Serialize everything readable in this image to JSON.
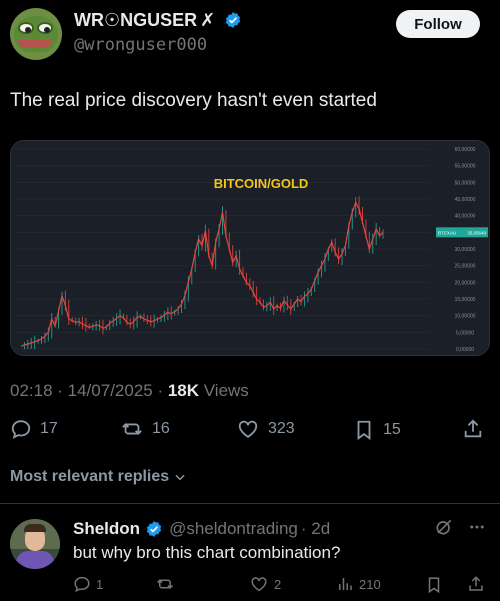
{
  "author": {
    "display_name": "WR☉NGUSER",
    "name_mark": "✗",
    "handle": "@wronguser000",
    "avatar_icon": "pepe-frog-avatar",
    "verified_icon": "verified-badge-icon",
    "verified_color": "#1d9bf0"
  },
  "follow_label": "Follow",
  "tweet": {
    "text": "The real price discovery hasn't even started",
    "timestamp": "02:18 · 14/07/2025 · ",
    "views_count": "18K",
    "views_label": " Views"
  },
  "actions": {
    "replies": "17",
    "reposts": "16",
    "likes": "323",
    "bookmarks": "15"
  },
  "replies_filter_label": "Most relevant replies",
  "reply": {
    "display_name": "Sheldon",
    "handle": "@sheldontrading",
    "age": "· 2d",
    "text": "but why bro this chart combination?",
    "replies": "1",
    "reposts": "",
    "likes": "2",
    "views": "210"
  },
  "chart_data": {
    "type": "line",
    "title": "BITCOIN/GOLD",
    "title_color": "#f5c518",
    "line_color": "#e8453c",
    "up_color": "#26a69a",
    "y_ticks": [
      "60,00000",
      "55,00000",
      "50,00000",
      "45,00000",
      "40,00000",
      "35,00000",
      "30,00000",
      "25,00000",
      "20,00000",
      "15,00000",
      "10,00000",
      "5,00000",
      "0,00000"
    ],
    "ylim": [
      0,
      60
    ],
    "price_tag_symbol": "BTCXAU",
    "price_tag_value": "35,05649",
    "price_tag_color": "#1fa89a",
    "series": [
      {
        "values": [
          0.8,
          1.2,
          1.5,
          1.8,
          2.2,
          2.5,
          3.0,
          3.8,
          5.0,
          9.0,
          7.0,
          11.5,
          16.0,
          13.0,
          9.0,
          8.5,
          8.0,
          8.2,
          7.5,
          7.0,
          6.5,
          6.8,
          7.2,
          7.0,
          6.2,
          6.6,
          7.8,
          8.4,
          9.2,
          10.0,
          9.4,
          8.0,
          7.4,
          8.2,
          9.5,
          9.8,
          9.0,
          8.6,
          8.2,
          8.5,
          9.0,
          9.4,
          10.2,
          11.0,
          10.6,
          11.2,
          12.0,
          13.5,
          16.0,
          20.0,
          24.0,
          29.0,
          33.0,
          31.0,
          35.5,
          28.0,
          25.0,
          32.0,
          36.0,
          41.0,
          34.0,
          30.0,
          26.0,
          28.0,
          24.0,
          22.0,
          20.0,
          19.0,
          17.0,
          15.0,
          14.0,
          12.5,
          13.0,
          14.0,
          12.0,
          13.0,
          12.2,
          14.5,
          13.2,
          12.0,
          13.5,
          15.0,
          14.2,
          15.8,
          16.5,
          18.0,
          20.5,
          23.0,
          25.0,
          27.0,
          30.0,
          32.0,
          29.0,
          27.0,
          28.5,
          31.0,
          37.0,
          41.0,
          44.0,
          42.0,
          38.0,
          34.0,
          30.0,
          33.0,
          36.0,
          34.0,
          35.0
        ]
      }
    ]
  }
}
